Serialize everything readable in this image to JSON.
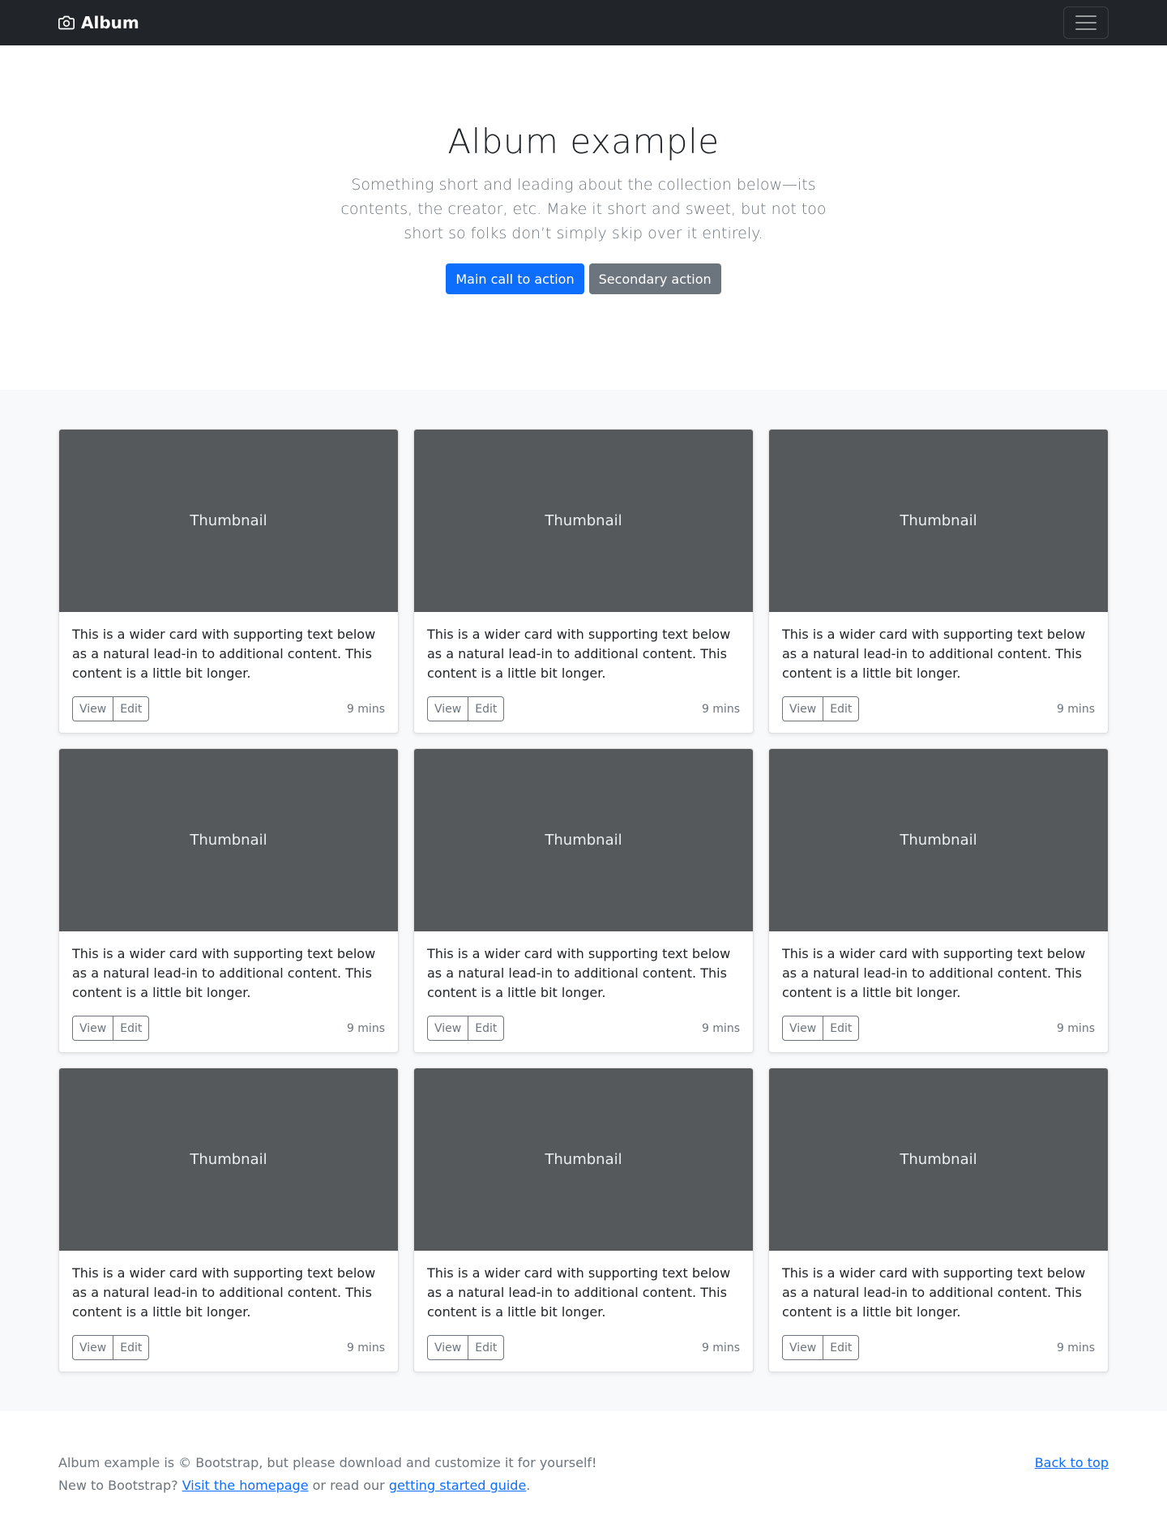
{
  "navbar": {
    "brand": "Album",
    "brand_icon": "camera-icon",
    "toggler_icon": "hamburger-menu-icon"
  },
  "hero": {
    "title": "Album example",
    "lead": "Something short and leading about the collection below—its contents, the creator, etc. Make it short and sweet, but not too short so folks don’t simply skip over it entirely.",
    "primary_button": "Main call to action",
    "secondary_button": "Secondary action"
  },
  "cards": [
    {
      "thumbnail": "Thumbnail",
      "text": "This is a wider card with supporting text below as a natural lead-in to additional content. This content is a little bit longer.",
      "view": "View",
      "edit": "Edit",
      "time": "9 mins"
    },
    {
      "thumbnail": "Thumbnail",
      "text": "This is a wider card with supporting text below as a natural lead-in to additional content. This content is a little bit longer.",
      "view": "View",
      "edit": "Edit",
      "time": "9 mins"
    },
    {
      "thumbnail": "Thumbnail",
      "text": "This is a wider card with supporting text below as a natural lead-in to additional content. This content is a little bit longer.",
      "view": "View",
      "edit": "Edit",
      "time": "9 mins"
    },
    {
      "thumbnail": "Thumbnail",
      "text": "This is a wider card with supporting text below as a natural lead-in to additional content. This content is a little bit longer.",
      "view": "View",
      "edit": "Edit",
      "time": "9 mins"
    },
    {
      "thumbnail": "Thumbnail",
      "text": "This is a wider card with supporting text below as a natural lead-in to additional content. This content is a little bit longer.",
      "view": "View",
      "edit": "Edit",
      "time": "9 mins"
    },
    {
      "thumbnail": "Thumbnail",
      "text": "This is a wider card with supporting text below as a natural lead-in to additional content. This content is a little bit longer.",
      "view": "View",
      "edit": "Edit",
      "time": "9 mins"
    },
    {
      "thumbnail": "Thumbnail",
      "text": "This is a wider card with supporting text below as a natural lead-in to additional content. This content is a little bit longer.",
      "view": "View",
      "edit": "Edit",
      "time": "9 mins"
    },
    {
      "thumbnail": "Thumbnail",
      "text": "This is a wider card with supporting text below as a natural lead-in to additional content. This content is a little bit longer.",
      "view": "View",
      "edit": "Edit",
      "time": "9 mins"
    },
    {
      "thumbnail": "Thumbnail",
      "text": "This is a wider card with supporting text below as a natural lead-in to additional content. This content is a little bit longer.",
      "view": "View",
      "edit": "Edit",
      "time": "9 mins"
    }
  ],
  "footer": {
    "line1": "Album example is © Bootstrap, but please download and customize it for yourself!",
    "line2_prefix": "New to Bootstrap?",
    "homepage_link": "Visit the homepage",
    "line2_middle": "or read our",
    "guide_link": "getting started guide",
    "line2_suffix": ".",
    "back_to_top": "Back to top"
  },
  "colors": {
    "navbar_bg": "#212529",
    "primary": "#0d6efd",
    "secondary": "#6c757d",
    "thumbnail_bg": "#55595c",
    "album_bg": "#f8f9fa"
  }
}
